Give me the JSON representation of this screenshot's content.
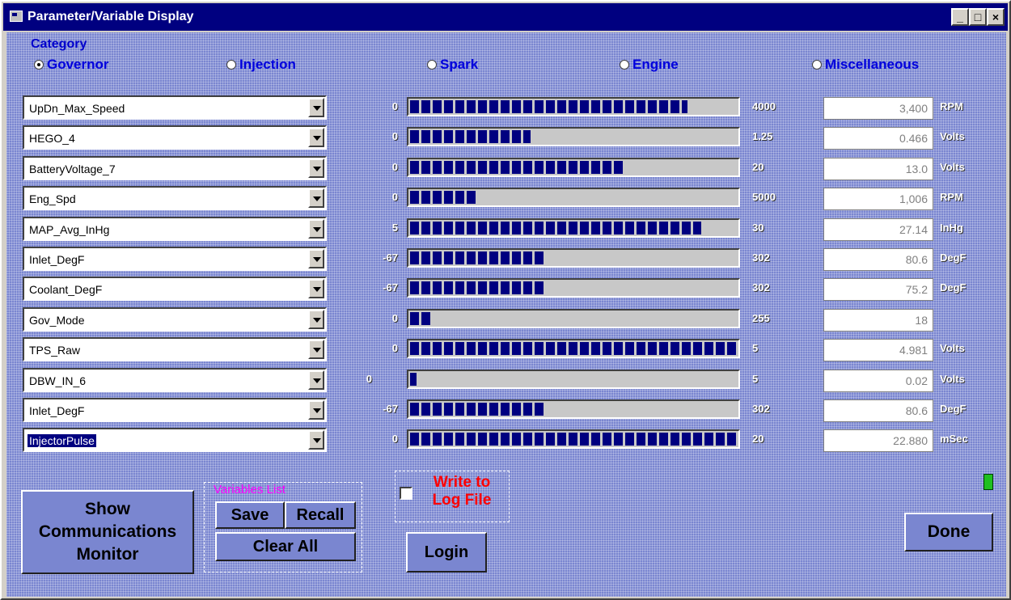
{
  "window": {
    "title": "Parameter/Variable Display"
  },
  "category": {
    "label": "Category",
    "options": [
      "Governor",
      "Injection",
      "Spark",
      "Engine",
      "Miscellaneous"
    ],
    "selected": "Governor"
  },
  "rows": [
    {
      "name": "UpDn_Max_Speed",
      "min": "0",
      "max": "4000",
      "fill": 0.85,
      "value": "3,400",
      "unit": "RPM"
    },
    {
      "name": "HEGO_4",
      "min": "0",
      "max": "1.25",
      "fill": 0.37,
      "value": "0.466",
      "unit": "Volts"
    },
    {
      "name": "BatteryVoltage_7",
      "min": "0",
      "max": "20",
      "fill": 0.65,
      "value": "13.0",
      "unit": "Volts"
    },
    {
      "name": "Eng_Spd",
      "min": "0",
      "max": "5000",
      "fill": 0.2,
      "value": "1,006",
      "unit": "RPM"
    },
    {
      "name": "MAP_Avg_InHg",
      "min": "5",
      "max": "30",
      "fill": 0.89,
      "value": "27.14",
      "unit": "InHg"
    },
    {
      "name": "Inlet_DegF",
      "min": "-67",
      "max": "302",
      "fill": 0.41,
      "value": "80.6",
      "unit": "DegF"
    },
    {
      "name": "Coolant_DegF",
      "min": "-67",
      "max": "302",
      "fill": 0.41,
      "value": "75.2",
      "unit": "DegF"
    },
    {
      "name": "Gov_Mode",
      "min": "0",
      "max": "255",
      "fill": 0.07,
      "value": "18",
      "unit": ""
    },
    {
      "name": "TPS_Raw",
      "min": "0",
      "max": "5",
      "fill": 1.0,
      "value": "4.981",
      "unit": "Volts"
    },
    {
      "name": "DBW_IN_6",
      "min": "0",
      "max": "5",
      "fill": 0.02,
      "value": "0.02",
      "unit": "Volts"
    },
    {
      "name": "Inlet_DegF",
      "min": "-67",
      "max": "302",
      "fill": 0.41,
      "value": "80.6",
      "unit": "DegF"
    },
    {
      "name": "InjectorPulse",
      "min": "0",
      "max": "20",
      "fill": 1.0,
      "value": "22.880",
      "unit": "mSec"
    }
  ],
  "buttons": {
    "comm_monitor": "Show Communications Monitor",
    "variables_list": "Variables List",
    "save": "Save",
    "recall": "Recall",
    "clear_all": "Clear All",
    "write_log": "Write to Log File",
    "login": "Login",
    "done": "Done"
  },
  "colors": {
    "titlebar": "#000080",
    "bar_fill": "#000080",
    "background": "#7a86d0",
    "accent_text": "#0000dd",
    "log_text": "#ff0000",
    "vars_text": "#ff00ff"
  }
}
